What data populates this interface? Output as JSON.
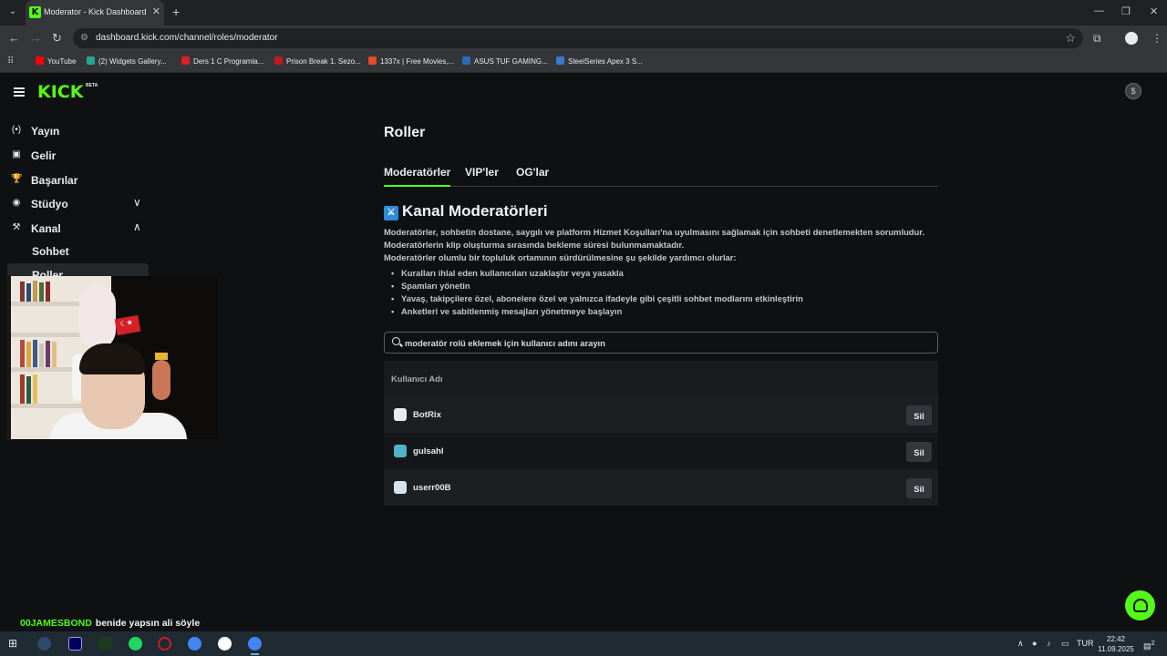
{
  "browser": {
    "tab_title": "Moderator - Kick Dashboard",
    "tab_favicon": "K",
    "url": "dashboard.kick.com/channel/roles/moderator",
    "bookmarks": [
      {
        "label": "YouTube",
        "color": "#ff0000"
      },
      {
        "label": "(2) Widgets Gallery...",
        "color": "#2aa58f"
      },
      {
        "label": "Ders 1 C Programla...",
        "color": "#e02020"
      },
      {
        "label": "Prison Break 1. Sezo...",
        "color": "#c0191f"
      },
      {
        "label": "1337x | Free Movies,...",
        "color": "#e54b24"
      },
      {
        "label": "ASUS TUF GAMING...",
        "color": "#2a6ebb"
      },
      {
        "label": "SteelSeries Apex 3 S...",
        "color": "#3a78d6"
      }
    ]
  },
  "header": {
    "logo": "KICK",
    "logo_badge": "BETA",
    "accent": "#53fc18"
  },
  "sidebar": {
    "items": [
      {
        "label": "Yayın",
        "icon": "broadcast-icon",
        "glyph": "(•)"
      },
      {
        "label": "Gelir",
        "icon": "revenue-icon",
        "glyph": "▣"
      },
      {
        "label": "Başarılar",
        "icon": "trophy-icon",
        "glyph": "🏆"
      },
      {
        "label": "Stüdyo",
        "icon": "studio-icon",
        "glyph": "◉",
        "chevron": "∨"
      },
      {
        "label": "Kanal",
        "icon": "channel-icon",
        "glyph": "⚒",
        "chevron": "∧"
      }
    ],
    "sub_items": [
      "Sohbet",
      "Roller"
    ]
  },
  "main": {
    "title": "Roller",
    "tabs": [
      "Moderatörler",
      "VIP'ler",
      "OG'lar"
    ],
    "section_title": "Kanal Moderatörleri",
    "description": [
      "Moderatörler, sohbetin dostane, saygılı ve platform Hizmet Koşulları'na uyulmasını sağlamak için sohbeti denetlemekten sorumludur.",
      "Moderatörlerin klip oluşturma sırasında bekleme süresi bulunmamaktadır.",
      "Moderatörler olumlu bir topluluk ortamının sürdürülmesine şu şekilde yardımcı olurlar:"
    ],
    "bullets": [
      "Kuralları ihlal eden kullanıcıları uzaklaştır veya yasakla",
      "Spamları yönetin",
      "Yavaş, takipçilere özel, abonelere özel ve yalnızca ifadeyle gibi çeşitli sohbet modlarını etkinleştirin",
      "Anketleri ve sabitlenmiş mesajları yönetmeye başlayın"
    ],
    "search_placeholder": "moderatör rolü eklemek için kullanıcı adını arayın",
    "table": {
      "header": "Kullanıcı Adı",
      "rows": [
        {
          "username": "BotRix",
          "action": "Sil"
        },
        {
          "username": "gulsahl",
          "action": "Sil"
        },
        {
          "username": "userr00B",
          "action": "Sil"
        }
      ]
    }
  },
  "chat_overlay": {
    "username": "00JAMESBOND",
    "message": "benide yapsın ali söyle"
  },
  "taskbar": {
    "language": "TUR",
    "time": "22:42",
    "date": "11.09.2025",
    "notifications": "2"
  }
}
